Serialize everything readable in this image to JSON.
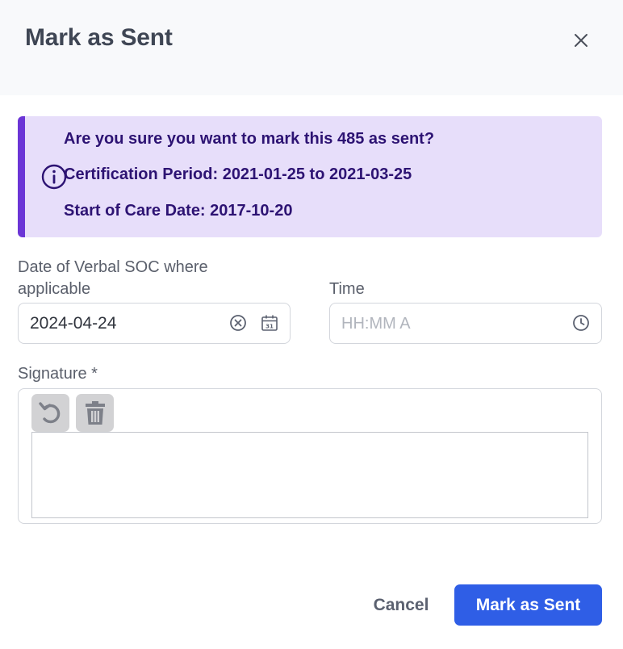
{
  "dialog": {
    "title": "Mark as Sent"
  },
  "alert": {
    "line1": "Are you sure you want to mark this 485 as sent?",
    "line2": "Certification Period: 2021-01-25 to 2021-03-25",
    "line3": "Start of Care Date: 2017-10-20",
    "icon": "info-icon"
  },
  "form": {
    "date_label": "Date of Verbal SOC where applicable",
    "date_value": "2024-04-24",
    "time_label": "Time",
    "time_placeholder": "HH:MM A",
    "calendar_day": "31",
    "signature_label": "Signature *"
  },
  "footer": {
    "cancel_label": "Cancel",
    "submit_label": "Mark as Sent"
  },
  "colors": {
    "accent": "#2f5ee6",
    "alert_bg": "#e7defa",
    "alert_border": "#6b35d6",
    "alert_text": "#2d1373"
  }
}
